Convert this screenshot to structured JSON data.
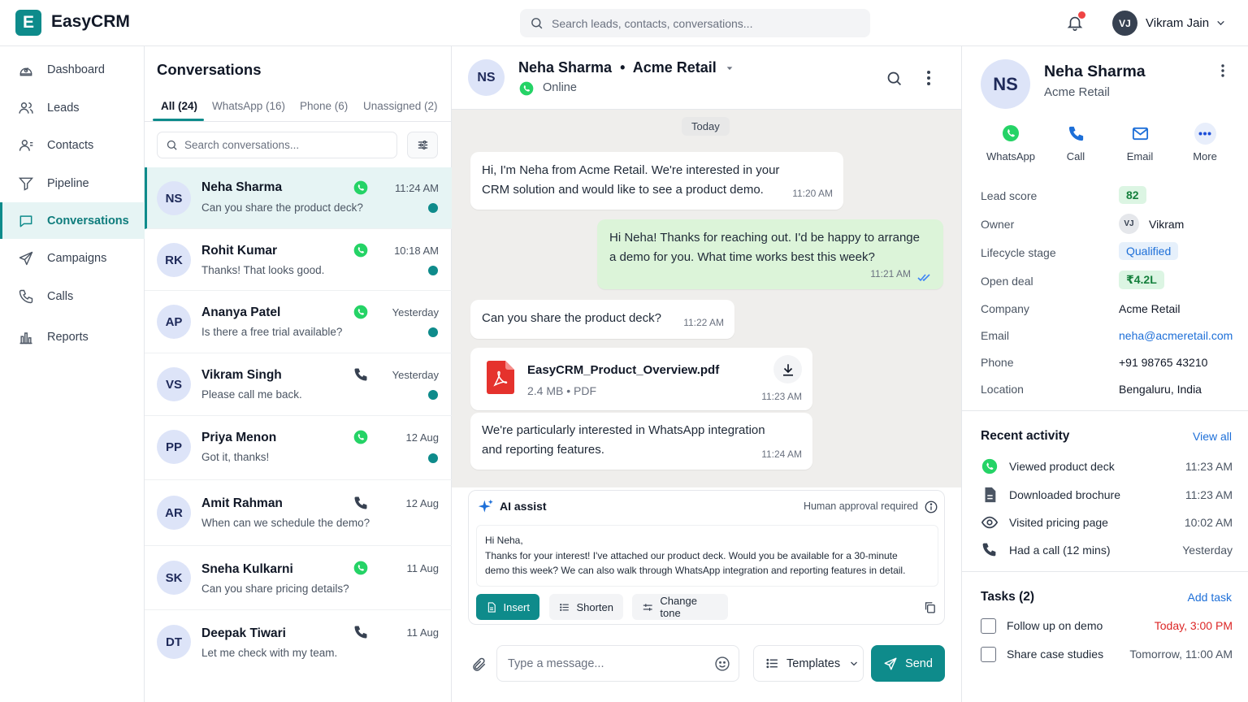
{
  "app": {
    "logo_letter": "E",
    "name": "EasyCRM"
  },
  "topbar": {
    "search_placeholder": "Search leads, contacts, conversations...",
    "user_initials": "VJ",
    "user_name": "Vikram Jain"
  },
  "nav": [
    {
      "label": "Dashboard",
      "icon": "dashboard-icon"
    },
    {
      "label": "Leads",
      "icon": "leads-icon"
    },
    {
      "label": "Contacts",
      "icon": "contacts-icon"
    },
    {
      "label": "Pipeline",
      "icon": "funnel-icon"
    },
    {
      "label": "Conversations",
      "icon": "chat-icon",
      "active": true
    },
    {
      "label": "Campaigns",
      "icon": "send-icon"
    },
    {
      "label": "Calls",
      "icon": "phone-icon"
    },
    {
      "label": "Reports",
      "icon": "bar-chart-icon"
    }
  ],
  "conversations": {
    "title": "Conversations",
    "tabs": [
      "All (24)",
      "WhatsApp (16)",
      "Phone (6)",
      "Unassigned (2)"
    ],
    "search_placeholder": "Search conversations...",
    "items": [
      {
        "initials": "NS",
        "name": "Neha Sharma",
        "preview": "Can you share the product deck?",
        "time": "11:24 AM",
        "channel": "whatsapp"
      },
      {
        "initials": "RK",
        "name": "Rohit Kumar",
        "preview": "Thanks! That looks good.",
        "time": "10:18 AM",
        "channel": "whatsapp"
      },
      {
        "initials": "AP",
        "name": "Ananya Patel",
        "preview": "Is there a free trial available?",
        "time": "Yesterday",
        "channel": "whatsapp"
      },
      {
        "initials": "VS",
        "name": "Vikram Singh",
        "preview": "Please call me back.",
        "time": "Yesterday",
        "channel": "phone"
      },
      {
        "initials": "PP",
        "name": "Priya Menon",
        "preview": "Got it, thanks!",
        "time": "12 Aug",
        "channel": "whatsapp"
      },
      {
        "initials": "AR",
        "name": "Amit Rahman",
        "preview": "When can we schedule the demo?",
        "time": "12 Aug",
        "channel": "phone"
      },
      {
        "initials": "SK",
        "name": "Sneha Kulkarni",
        "preview": "Can you share pricing details?",
        "time": "11 Aug",
        "channel": "whatsapp"
      },
      {
        "initials": "DT",
        "name": "Deepak Tiwari",
        "preview": "Let me check with my team.",
        "time": "11 Aug",
        "channel": "phone"
      }
    ]
  },
  "chat": {
    "initials": "NS",
    "name": "Neha Sharma",
    "separator": "•",
    "company": "Acme Retail",
    "status": "Online",
    "date_label": "Today",
    "messages": [
      {
        "dir": "in",
        "line1": "Hi, I'm Neha from Acme Retail. We're interested in your",
        "line2": "CRM solution and would like to see a product demo.",
        "time": "11:20 AM"
      },
      {
        "dir": "out",
        "line1": "Hi Neha! Thanks for reaching out. I'd be happy to arrange",
        "line2": "a demo for you. What time works best this week?",
        "time": "11:21 AM"
      },
      {
        "dir": "in",
        "line1": "Can you share the product deck?",
        "time": "11:22 AM"
      },
      {
        "dir": "in",
        "file_name": "EasyCRM_Product_Overview.pdf",
        "file_meta": "2.4 MB • PDF",
        "time": "11:23 AM"
      },
      {
        "dir": "in",
        "line1": "We're particularly interested in WhatsApp integration",
        "line2": "and reporting features.",
        "time": "11:24 AM"
      }
    ],
    "ai": {
      "title": "AI assist",
      "approval": "Human approval required",
      "greeting": "Hi Neha,",
      "body1": "Thanks for your interest! I've attached our product deck. Would you be available for a 30-minute",
      "body2": "demo this week? We can also walk through WhatsApp integration and reporting features in detail.",
      "insert": "Insert",
      "shorten": "Shorten",
      "change_tone": "Change tone"
    },
    "composer": {
      "placeholder": "Type a message...",
      "templates": "Templates",
      "send": "Send"
    }
  },
  "contact": {
    "initials": "NS",
    "name": "Neha Sharma",
    "company": "Acme Retail",
    "actions": [
      "WhatsApp",
      "Call",
      "Email",
      "More"
    ],
    "fields": {
      "lead_score_label": "Lead score",
      "lead_score": "82",
      "owner_label": "Owner",
      "owner_initials": "VJ",
      "owner": "Vikram",
      "lifecycle_label": "Lifecycle stage",
      "lifecycle": "Qualified",
      "deal_label": "Open deal",
      "deal": "₹4.2L",
      "company_label": "Company",
      "company": "Acme Retail",
      "email_label": "Email",
      "email": "neha@acmeretail.com",
      "phone_label": "Phone",
      "phone": "+91 98765 43210",
      "location_label": "Location",
      "location": "Bengaluru, India"
    },
    "activity_title": "Recent activity",
    "view_all": "View all",
    "activity": [
      {
        "text": "Viewed product deck",
        "time": "11:23 AM"
      },
      {
        "text": "Downloaded brochure",
        "time": "11:23 AM"
      },
      {
        "text": "Visited pricing page",
        "time": "10:02 AM"
      },
      {
        "text": "Had a call (12 mins)",
        "time": "Yesterday"
      }
    ],
    "tasks_title": "Tasks (2)",
    "add_task": "Add task",
    "tasks": [
      {
        "text": "Follow up on demo",
        "time": "Today, 3:00 PM"
      },
      {
        "text": "Share case studies",
        "time": "Tomorrow, 11:00 AM"
      }
    ]
  },
  "colors": {
    "accent": "#0e8b8b",
    "whatsapp": "#25d366",
    "overdue": "#dc2626",
    "link": "#1d6fd8"
  }
}
